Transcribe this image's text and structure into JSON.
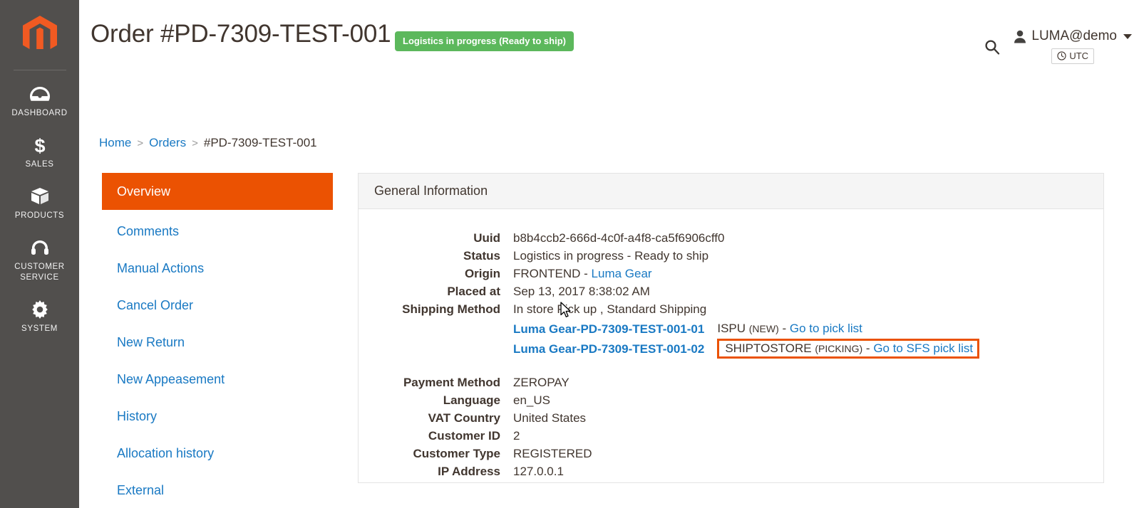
{
  "rail": {
    "logo_name": "magento-logo",
    "items": [
      {
        "icon": "dashboard-gauge-icon",
        "label": "DASHBOARD"
      },
      {
        "icon": "dollar-sign-icon",
        "label": "SALES"
      },
      {
        "icon": "box-icon",
        "label": "PRODUCTS"
      },
      {
        "icon": "headset-icon",
        "label": "CUSTOMER\nSERVICE"
      },
      {
        "icon": "gear-icon",
        "label": "SYSTEM"
      }
    ]
  },
  "header": {
    "title": "Order #PD-7309-TEST-001",
    "status_badge": "Logistics in progress (Ready to ship)",
    "status_badge_color": "#5cb85c",
    "search_icon": "search-icon",
    "user_icon": "user-avatar-icon",
    "user_name": "LUMA@demo",
    "timezone_icon": "clock-icon",
    "timezone": "UTC"
  },
  "breadcrumb": {
    "home": "Home",
    "separator": ">",
    "orders": "Orders",
    "current": "#PD-7309-TEST-001"
  },
  "leftnav": {
    "items": [
      {
        "label": "Overview",
        "active": true
      },
      {
        "label": "Comments",
        "active": false
      },
      {
        "label": "Manual Actions",
        "active": false
      },
      {
        "label": "Cancel Order",
        "active": false
      },
      {
        "label": "New Return",
        "active": false
      },
      {
        "label": "New Appeasement",
        "active": false
      },
      {
        "label": "History",
        "active": false
      },
      {
        "label": "Allocation history",
        "active": false
      },
      {
        "label": "External",
        "active": false
      }
    ],
    "active_color": "#eb5202",
    "link_color": "#1979c3"
  },
  "panel": {
    "title": "General Information",
    "fields_top": [
      {
        "label": "Uuid",
        "value": "b8b4ccb2-666d-4c0f-a4f8-ca5f6906cff0"
      },
      {
        "label": "Status",
        "value": "Logistics in progress - Ready to ship"
      },
      {
        "label": "Origin",
        "value": "FRONTEND - ",
        "link": "Luma Gear"
      },
      {
        "label": "Placed at",
        "value": "Sep 13, 2017 8:38:02 AM"
      },
      {
        "label": "Shipping Method",
        "value": "In store Pick up , Standard Shipping"
      }
    ],
    "shipments": [
      {
        "name": "Luma Gear-PD-7309-TEST-001-01",
        "type": "ISPU",
        "state": "(NEW)",
        "dash": " - ",
        "link": "Go to pick list",
        "highlighted": false
      },
      {
        "name": "Luma Gear-PD-7309-TEST-001-02",
        "type": "SHIPTOSTORE",
        "state": "(PICKING)",
        "dash": " - ",
        "link": "Go to SFS pick list",
        "highlighted": true
      }
    ],
    "highlight_color": "#eb5202",
    "fields_bottom": [
      {
        "label": "Payment Method",
        "value": "ZEROPAY"
      },
      {
        "label": "Language",
        "value": "en_US"
      },
      {
        "label": "VAT Country",
        "value": "United States"
      },
      {
        "label": "Customer ID",
        "value": "2"
      },
      {
        "label": "Customer Type",
        "value": "REGISTERED"
      },
      {
        "label": "IP Address",
        "value": "127.0.0.1"
      }
    ]
  }
}
